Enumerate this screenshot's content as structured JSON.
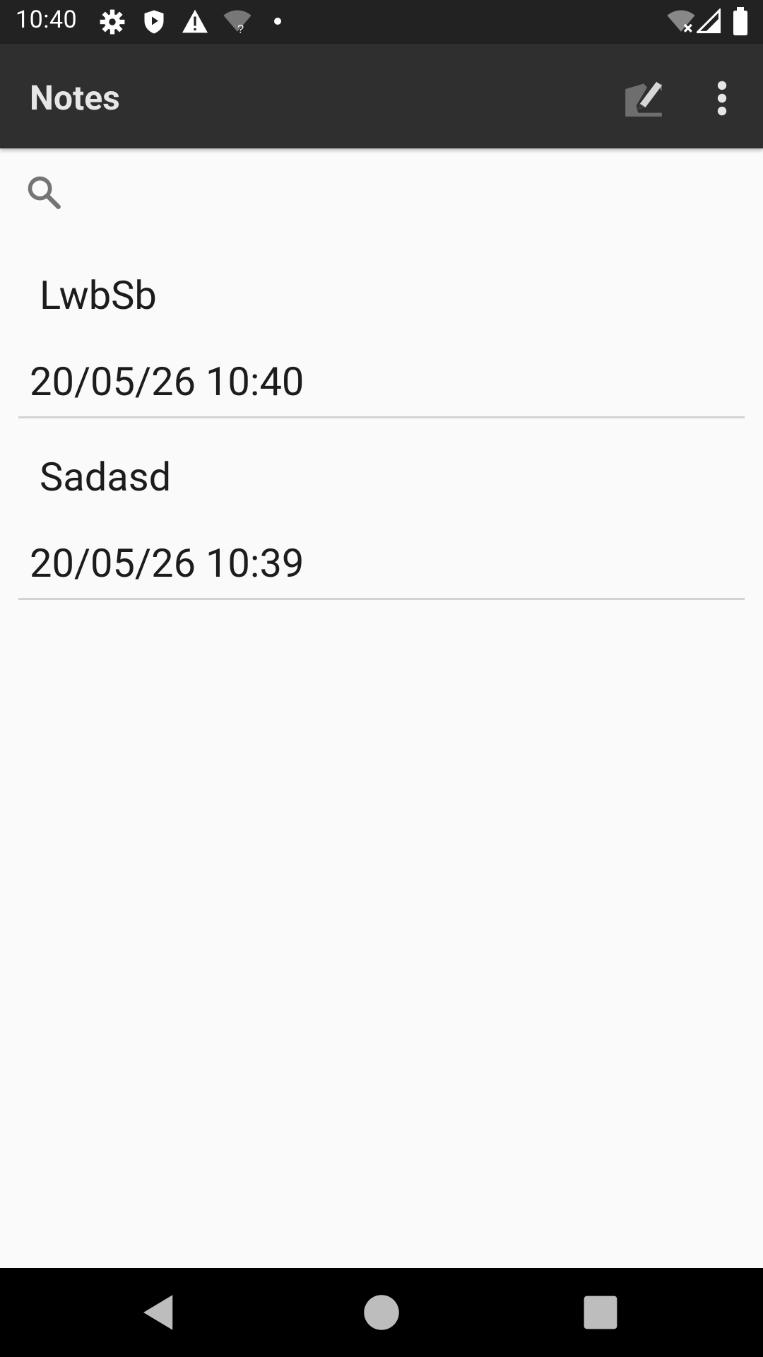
{
  "status_bar": {
    "time": "10:40",
    "icons_left": [
      "settings-icon",
      "shield-icon",
      "warning-icon",
      "wifi-question-icon",
      "dot-icon"
    ],
    "icons_right": [
      "wifi-off-icon",
      "signal-icon",
      "battery-icon"
    ]
  },
  "app_bar": {
    "title": "Notes",
    "actions": [
      "compose-icon",
      "more-vert-icon"
    ]
  },
  "search": {
    "value": "",
    "placeholder": ""
  },
  "notes": [
    {
      "title": "LwbSb",
      "date": "20/05/26 10:40"
    },
    {
      "title": "Sadasd",
      "date": "20/05/26 10:39"
    }
  ],
  "navigation": [
    "back-icon",
    "home-icon",
    "recents-icon"
  ],
  "colors": {
    "status_bar": "#222222",
    "app_bar": "#2f2f2f",
    "background": "#fafafa",
    "divider": "#d3d3d3",
    "nav_bar": "#000000"
  }
}
